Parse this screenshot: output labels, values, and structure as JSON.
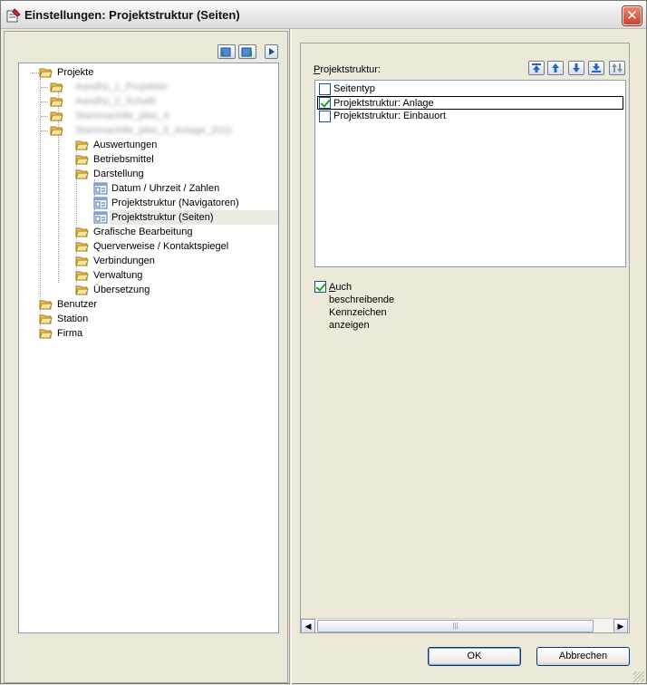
{
  "window": {
    "title": "Einstellungen: Projektstruktur (Seiten)",
    "close_glyph": "✕"
  },
  "tree": {
    "root_nodes": [
      {
        "label": "Projekte"
      },
      {
        "label": "Benutzer"
      },
      {
        "label": "Station"
      },
      {
        "label": "Firma"
      }
    ],
    "project_children_blurred": [
      {
        "label": "Aandhs_1_Projektstr"
      },
      {
        "label": "Aandhs_2_Schaltl"
      },
      {
        "label": "Stammachtle_plan_4"
      },
      {
        "label": "Stammachtle_plan_5_Anlage_2011"
      }
    ],
    "settings_children": [
      {
        "label": "Auswertungen"
      },
      {
        "label": "Betriebsmittel"
      },
      {
        "label": "Darstellung"
      },
      {
        "label": "Grafische Bearbeitung"
      },
      {
        "label": "Querverweise / Kontaktspiegel"
      },
      {
        "label": "Verbindungen"
      },
      {
        "label": "Verwaltung"
      },
      {
        "label": "Übersetzung"
      }
    ],
    "darstellung_children": [
      {
        "label": "Datum / Uhrzeit / Zahlen"
      },
      {
        "label": "Projektstruktur (Navigatoren)"
      },
      {
        "label": "Projektstruktur (Seiten)"
      }
    ]
  },
  "panel": {
    "label_prefix": "P",
    "label_rest": "rojektstruktur:",
    "list": [
      {
        "label": "Seitentyp",
        "checked": false
      },
      {
        "label": "Projektstruktur: Anlage",
        "checked": true
      },
      {
        "label": "Projektstruktur: Einbauort",
        "checked": false
      }
    ],
    "option_prefix": "A",
    "option_rest": "uch beschreibende Kennzeichen anzeigen",
    "option_checked": true,
    "scroll_thumb_grip": "|||",
    "scroll_left": "◀",
    "scroll_right": "▶"
  },
  "buttons": {
    "ok": "OK",
    "cancel": "Abbrechen"
  },
  "colors": {
    "accent_blue": "#316ac5",
    "check_green": "#21a121",
    "folder_yellow": "#f3c75a"
  }
}
